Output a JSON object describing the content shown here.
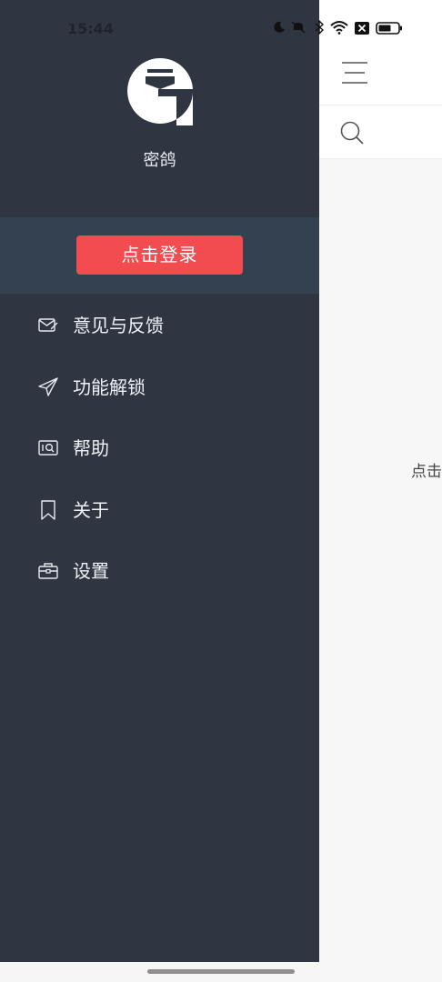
{
  "status_bar": {
    "time": "15:44",
    "icons": [
      "moon-icon",
      "mute-icon",
      "bluetooth-icon",
      "wifi-icon",
      "sim-off-icon",
      "battery-icon"
    ]
  },
  "drawer": {
    "app_name": "密鸽",
    "logo": "logo-icon",
    "login_label": "点击登录",
    "menu": [
      {
        "label": "意见与反馈",
        "icon": "feedback-mail-icon"
      },
      {
        "label": "功能解锁",
        "icon": "paper-plane-icon"
      },
      {
        "label": "帮助",
        "icon": "help-icon"
      },
      {
        "label": "关于",
        "icon": "bookmark-icon"
      },
      {
        "label": "设置",
        "icon": "toolbox-icon"
      }
    ]
  },
  "main": {
    "hint": "点击"
  },
  "colors": {
    "drawer_bg": "#2f3541",
    "login_panel_bg": "#344150",
    "login_button": "#f24b50",
    "main_bg": "#f7f7f7"
  }
}
